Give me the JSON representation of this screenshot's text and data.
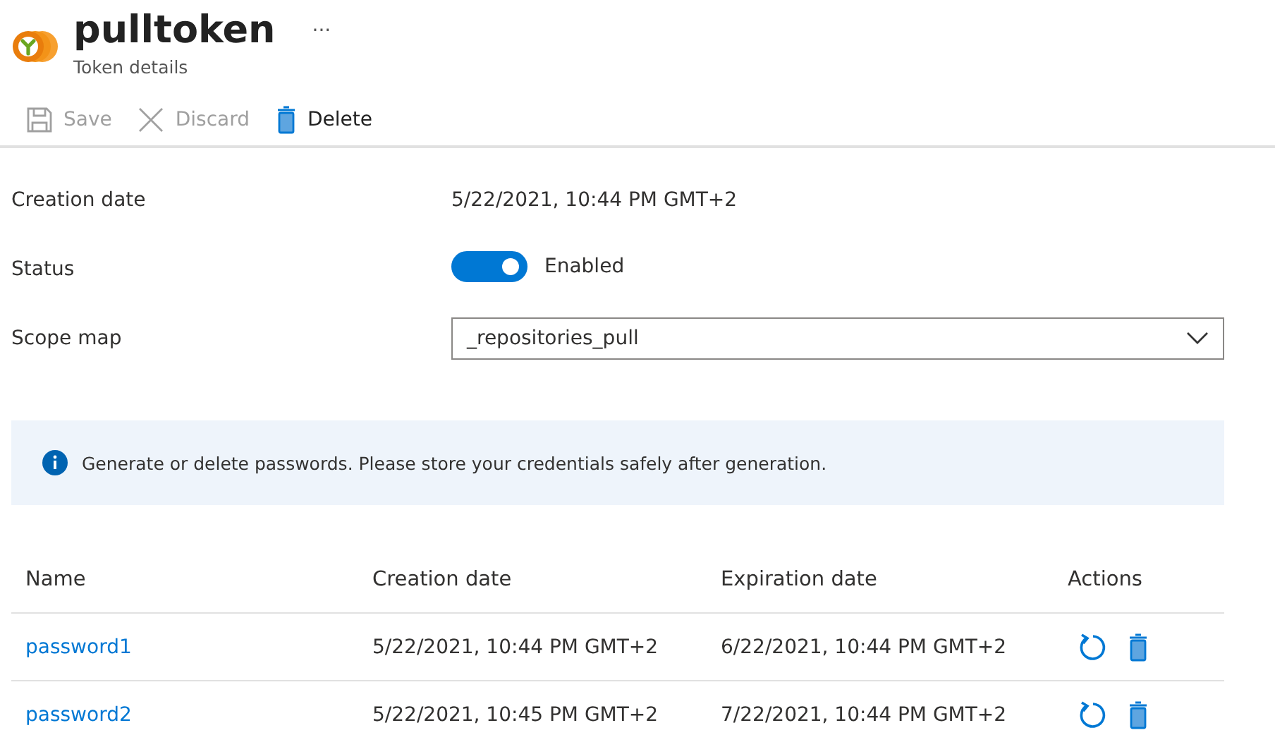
{
  "header": {
    "title": "pulltoken",
    "subtitle": "Token details",
    "more": "···"
  },
  "toolbar": [
    {
      "kind": "save",
      "label": "Save",
      "disabled": true
    },
    {
      "kind": "discard",
      "label": "Discard",
      "disabled": true
    },
    {
      "kind": "delete",
      "label": "Delete",
      "disabled": false
    }
  ],
  "fields": [
    {
      "kind": "text",
      "label": "Creation date",
      "value": "5/22/2021, 10:44 PM GMT+2"
    },
    {
      "kind": "toggle",
      "label": "Status",
      "on": true,
      "value": "Enabled"
    },
    {
      "kind": "dropdown",
      "label": "Scope map",
      "value": "_repositories_pull"
    }
  ],
  "info": "Generate or delete passwords. Please store your credentials safely after generation.",
  "table": {
    "columns": [
      "Name",
      "Creation date",
      "Expiration date",
      "Actions"
    ],
    "rows": [
      {
        "name": "password1",
        "created": "5/22/2021, 10:44 PM GMT+2",
        "expires": "6/22/2021, 10:44 PM GMT+2"
      },
      {
        "name": "password2",
        "created": "5/22/2021, 10:45 PM GMT+2",
        "expires": "7/22/2021, 10:44 PM GMT+2"
      }
    ]
  }
}
